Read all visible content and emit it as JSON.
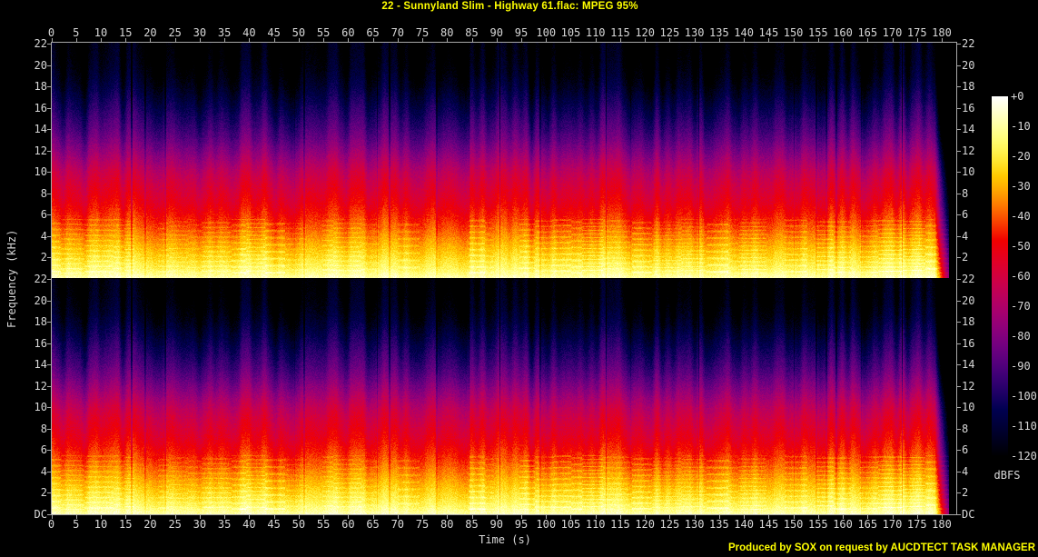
{
  "title": "22 - Sunnyland Slim - Highway 61.flac: MPEG 95%",
  "footer": "Produced by SOX on request by AUCDTECT TASK MANAGER",
  "axes": {
    "time_label": "Time (s)",
    "freq_label": "Frequency (kHz)",
    "db_label": "dBFS",
    "time_ticks": [
      0,
      5,
      10,
      15,
      20,
      25,
      30,
      35,
      40,
      45,
      50,
      55,
      60,
      65,
      70,
      75,
      80,
      85,
      90,
      95,
      100,
      105,
      110,
      115,
      120,
      125,
      130,
      135,
      140,
      145,
      150,
      155,
      160,
      165,
      170,
      175,
      180
    ],
    "freq_ticks_ch1": [
      "22",
      "20",
      "18",
      "16",
      "14",
      "12",
      "10",
      "8",
      "6",
      "4",
      "2"
    ],
    "freq_ticks_ch2": [
      "22",
      "20",
      "18",
      "16",
      "14",
      "12",
      "10",
      "8",
      "6",
      "4",
      "2",
      "DC"
    ],
    "db_ticks": [
      "+0",
      "-10",
      "-20",
      "-30",
      "-40",
      "-50",
      "-60",
      "-70",
      "-80",
      "-90",
      "-100",
      "-110",
      "-120"
    ]
  },
  "colors": {
    "background": "#000000",
    "title_text": "#ffff00",
    "footer_text": "#ffff00",
    "axis_text": "#d8d8d8",
    "frame_line": "#a8a8a8"
  },
  "chart_data": {
    "type": "heatmap",
    "subtype": "audio_spectrogram",
    "title": "22 - Sunnyland Slim - Highway 61.flac: MPEG 95%",
    "channels": [
      "channel-1-top",
      "channel-2-bottom"
    ],
    "x_axis": {
      "label": "Time (s)",
      "min": 0,
      "max": 180,
      "tick_step": 5
    },
    "y_axis": {
      "label": "Frequency (kHz)",
      "min": 0,
      "max": 22,
      "tick_step": 2,
      "bottom_tick_label": "DC"
    },
    "z_axis": {
      "label": "dBFS",
      "min": -120,
      "max": 0,
      "tick_step": 10
    },
    "legend_position": "right-colorbar",
    "grid": false,
    "duration_seconds": 181,
    "colormap_stops": [
      {
        "dbfs": 0,
        "color": "#ffffff"
      },
      {
        "dbfs": -10,
        "color": "#ffff9e"
      },
      {
        "dbfs": -20,
        "color": "#ffec3d"
      },
      {
        "dbfs": -30,
        "color": "#ffb000"
      },
      {
        "dbfs": -40,
        "color": "#fb5500"
      },
      {
        "dbfs": -50,
        "color": "#ec000b"
      },
      {
        "dbfs": -60,
        "color": "#d2003f"
      },
      {
        "dbfs": -70,
        "color": "#ae006a"
      },
      {
        "dbfs": -80,
        "color": "#81007e"
      },
      {
        "dbfs": -90,
        "color": "#4f007b"
      },
      {
        "dbfs": -100,
        "color": "#190062"
      },
      {
        "dbfs": -110,
        "color": "#000036"
      },
      {
        "dbfs": -120,
        "color": "#000000"
      }
    ],
    "avg_level_profile_khz_dbfs": [
      [
        0,
        -6
      ],
      [
        0.5,
        -11
      ],
      [
        1,
        -16
      ],
      [
        2,
        -22
      ],
      [
        3,
        -28
      ],
      [
        4,
        -34
      ],
      [
        5,
        -40
      ],
      [
        6,
        -45
      ],
      [
        7,
        -50
      ],
      [
        8,
        -54
      ],
      [
        9,
        -58
      ],
      [
        10,
        -63
      ],
      [
        11,
        -70
      ],
      [
        12,
        -77
      ],
      [
        13,
        -84
      ],
      [
        14,
        -90
      ],
      [
        15,
        -95
      ],
      [
        16,
        -100
      ],
      [
        17,
        -105
      ],
      [
        18,
        -110
      ],
      [
        19,
        -114
      ],
      [
        20,
        -117
      ],
      [
        21,
        -119
      ],
      [
        22,
        -120
      ]
    ]
  }
}
